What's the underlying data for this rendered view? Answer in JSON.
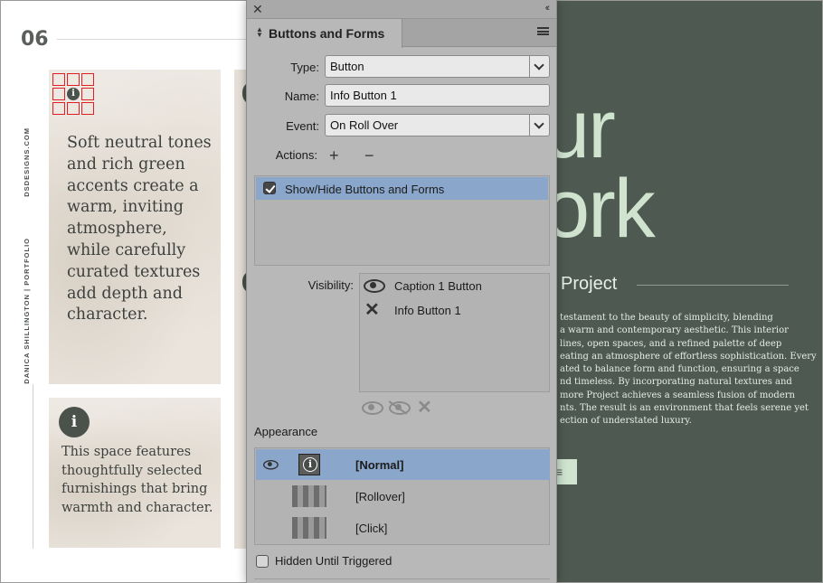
{
  "document": {
    "page_number": "06",
    "sidebar_site": "DSDESIGNS.COM",
    "sidebar_portfolio": "DANICA SHILLINGTON | PORTFOLIO",
    "card1_text": "Soft neutral tones and rich green accents create a warm, inviting atmosphere, while carefully curated textures add depth and character.",
    "card2_text": "This space features thoughtfully selected furnishings that bring warmth and character.",
    "info_glyph": "i",
    "heading_line1": "ur",
    "heading_line2": "ork",
    "project_title": "Project",
    "body_lines": [
      "testament to the beauty of simplicity, blending",
      "a warm and contemporary aesthetic. This interior",
      "lines, open spaces, and a refined palette of deep",
      "eating an atmosphere of effortless sophistication. Every",
      "ated to balance form and function, ensuring a space",
      "nd timeless. By incorporating natural textures and",
      "more Project achieves a seamless fusion of modern",
      "nts. The result is an environment that feels serene yet",
      "ection of understated luxury."
    ],
    "green_button_glyph": "≡",
    "colors": {
      "green_panel": "#4e5a51",
      "heading_mint": "#cfe3cf",
      "card_bg": "#efeae4"
    }
  },
  "panel": {
    "title": "Buttons and Forms",
    "close_glyph": "✕",
    "collapse_glyph": "‹‹",
    "type_label": "Type:",
    "type_value": "Button",
    "name_label": "Name:",
    "name_value": "Info Button 1",
    "event_label": "Event:",
    "event_value": "On Roll Over",
    "actions_label": "Actions:",
    "add_action_glyph": "+",
    "remove_action_glyph": "−",
    "actions": [
      {
        "label": "Show/Hide Buttons and Forms",
        "checked": true
      }
    ],
    "visibility_label": "Visibility:",
    "visibility_items": [
      {
        "state": "show",
        "label": "Caption 1 Button"
      },
      {
        "state": "hide",
        "label": "Info Button 1"
      }
    ],
    "visibility_x_glyph": "✕",
    "appearance_label": "Appearance",
    "appearance_states": [
      {
        "label": "[Normal]",
        "selected": true
      },
      {
        "label": "[Rollover]",
        "selected": false
      },
      {
        "label": "[Click]",
        "selected": false
      }
    ],
    "hidden_until_triggered_label": "Hidden Until Triggered",
    "selection_color": "#8aa7cb"
  }
}
